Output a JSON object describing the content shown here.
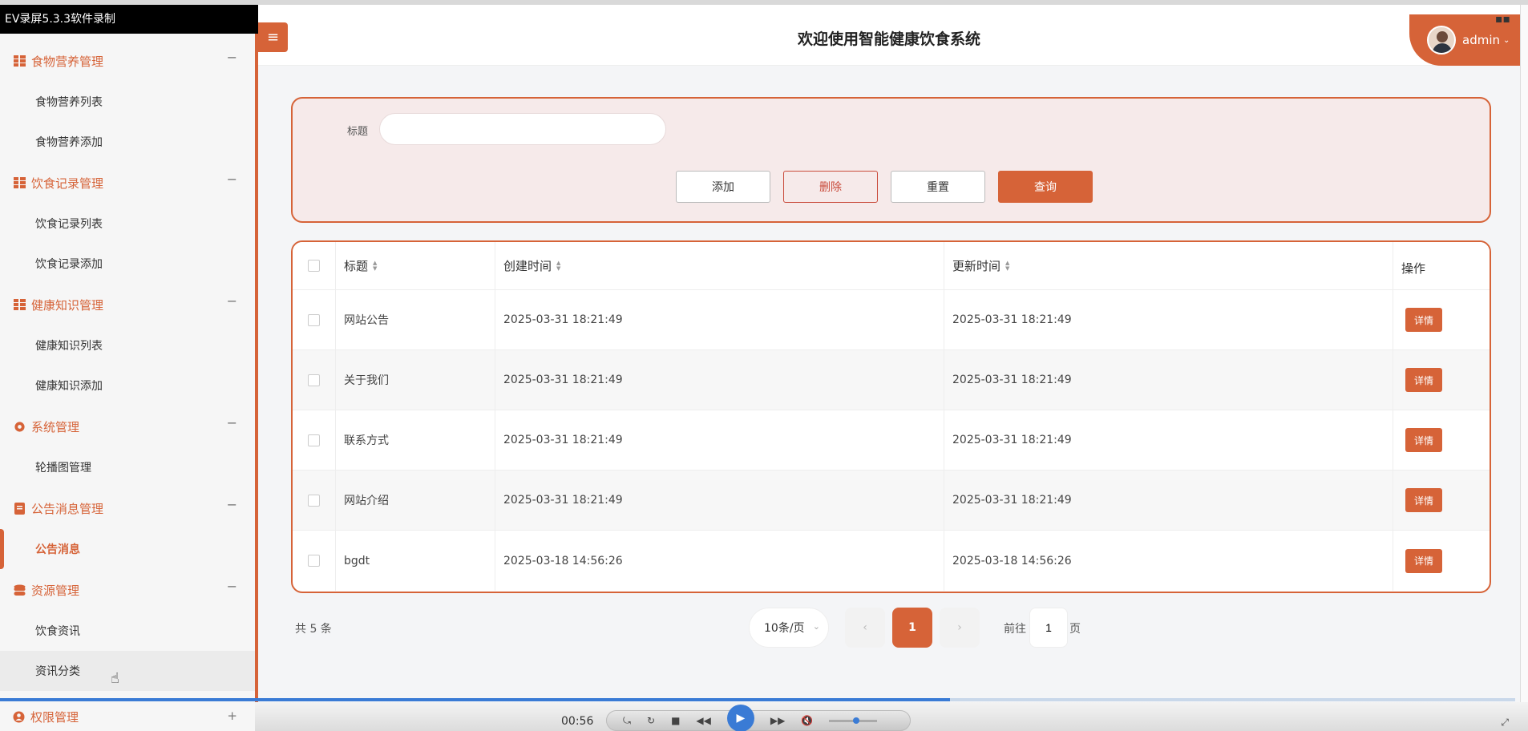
{
  "recorder": {
    "title": "EV录屏5.3.3软件录制",
    "time": "00:56"
  },
  "header": {
    "title": "欢迎使用智能健康饮食系统",
    "user": "admin",
    "menu_icon": "≡"
  },
  "sidebar": {
    "groups": [
      {
        "label": "食物营养管理",
        "icon": "grid-icon",
        "toggle": "−",
        "items": [
          "食物营养列表",
          "食物营养添加"
        ]
      },
      {
        "label": "饮食记录管理",
        "icon": "grid-icon",
        "toggle": "−",
        "items": [
          "饮食记录列表",
          "饮食记录添加"
        ]
      },
      {
        "label": "健康知识管理",
        "icon": "grid-icon",
        "toggle": "−",
        "items": [
          "健康知识列表",
          "健康知识添加"
        ]
      },
      {
        "label": "系统管理",
        "icon": "gear-icon",
        "toggle": "−",
        "items": [
          "轮播图管理"
        ]
      },
      {
        "label": "公告消息管理",
        "icon": "document-icon",
        "toggle": "−",
        "items": [
          "公告消息"
        ]
      },
      {
        "label": "资源管理",
        "icon": "database-icon",
        "toggle": "−",
        "items": [
          "饮食资讯",
          "资讯分类"
        ]
      },
      {
        "label": "权限管理",
        "icon": "user-icon",
        "toggle": "+",
        "items": []
      }
    ]
  },
  "search": {
    "title_label": "标题",
    "title_value": "",
    "buttons": {
      "add": "添加",
      "delete": "删除",
      "reset": "重置",
      "query": "查询"
    }
  },
  "table": {
    "columns": {
      "title": "标题",
      "created": "创建时间",
      "updated": "更新时间",
      "op": "操作"
    },
    "detail_label": "详情",
    "rows": [
      {
        "title": "网站公告",
        "created": "2025-03-31 18:21:49",
        "updated": "2025-03-31 18:21:49"
      },
      {
        "title": "关于我们",
        "created": "2025-03-31 18:21:49",
        "updated": "2025-03-31 18:21:49"
      },
      {
        "title": "联系方式",
        "created": "2025-03-31 18:21:49",
        "updated": "2025-03-31 18:21:49"
      },
      {
        "title": "网站介绍",
        "created": "2025-03-31 18:21:49",
        "updated": "2025-03-31 18:21:49"
      },
      {
        "title": "bgdt",
        "created": "2025-03-18 14:56:26",
        "updated": "2025-03-18 14:56:26"
      }
    ]
  },
  "pagination": {
    "total": "共 5 条",
    "page_size": "10条/页",
    "current": "1",
    "goto_label": "前往",
    "goto_value": "1",
    "goto_suffix": "页"
  },
  "colors": {
    "accent": "#d66338",
    "danger": "#c94b3b"
  },
  "player": {
    "progress": 0.627
  }
}
